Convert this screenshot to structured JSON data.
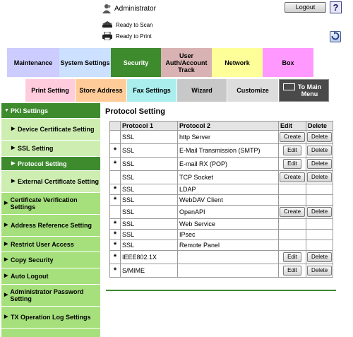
{
  "header": {
    "user": "Administrator",
    "logout_label": "Logout",
    "help_label": "?",
    "status_scan": "Ready to Scan",
    "status_print": "Ready to Print"
  },
  "tabs": [
    {
      "label": "Maintenance",
      "color": "#ccccff"
    },
    {
      "label": "System Settings",
      "color": "#cce0ff"
    },
    {
      "label": "Security",
      "color": "#3e8b2e",
      "active": true
    },
    {
      "label": "User Auth/Account Track",
      "color": "#d9b3b3"
    },
    {
      "label": "Network",
      "color": "#ffff99"
    },
    {
      "label": "Box",
      "color": "#ff99ff"
    }
  ],
  "subtabs": [
    {
      "label": "Print Setting",
      "color": "#ffccdd"
    },
    {
      "label": "Store Address",
      "color": "#ffcc99"
    },
    {
      "label": "Fax Settings",
      "color": "#aaeeee"
    },
    {
      "label": "Wizard",
      "color": "#c8c8c8"
    },
    {
      "label": "Customize",
      "color": "#dddddd"
    },
    {
      "label": "To Main Menu",
      "color": "#4a4a4a"
    }
  ],
  "sidebar": {
    "items": [
      {
        "label": "PKI Settings",
        "kind": "header"
      },
      {
        "label": "Device Certificate Setting",
        "kind": "sub"
      },
      {
        "label": "SSL Setting",
        "kind": "sub"
      },
      {
        "label": "Protocol Setting",
        "kind": "sub-active"
      },
      {
        "label": "External Certificate Setting",
        "kind": "sub"
      },
      {
        "label": "Certificate Verification Settings",
        "kind": "top"
      },
      {
        "label": "Address Reference Setting",
        "kind": "top"
      },
      {
        "label": "Restrict User Access",
        "kind": "top"
      },
      {
        "label": "Copy Security",
        "kind": "top"
      },
      {
        "label": "Auto Logout",
        "kind": "top"
      },
      {
        "label": "Administrator Password Setting",
        "kind": "top"
      },
      {
        "label": "TX Operation Log Settings",
        "kind": "top"
      }
    ]
  },
  "main": {
    "title": "Protocol Setting",
    "columns": [
      "",
      "Protocol 1",
      "Protocol 2",
      "Edit",
      "Delete"
    ],
    "rows": [
      {
        "star": "",
        "p1": "SSL",
        "p2": "http Server",
        "edit": "Create",
        "delete": "Delete"
      },
      {
        "star": "*",
        "p1": "SSL",
        "p2": "E-Mail Transmission (SMTP)",
        "edit": "Edit",
        "delete": "Delete"
      },
      {
        "star": "*",
        "p1": "SSL",
        "p2": "E-mail RX (POP)",
        "edit": "Edit",
        "delete": "Delete"
      },
      {
        "star": "",
        "p1": "SSL",
        "p2": "TCP Socket",
        "edit": "Create",
        "delete": "Delete"
      },
      {
        "star": "*",
        "p1": "SSL",
        "p2": "LDAP",
        "edit": "",
        "delete": ""
      },
      {
        "star": "*",
        "p1": "SSL",
        "p2": "WebDAV Client",
        "edit": "",
        "delete": ""
      },
      {
        "star": "",
        "p1": "SSL",
        "p2": "OpenAPI",
        "edit": "Create",
        "delete": "Delete"
      },
      {
        "star": "*",
        "p1": "SSL",
        "p2": "Web Service",
        "edit": "",
        "delete": ""
      },
      {
        "star": "*",
        "p1": "SSL",
        "p2": "IPsec",
        "edit": "",
        "delete": ""
      },
      {
        "star": "*",
        "p1": "SSL",
        "p2": "Remote Panel",
        "edit": "",
        "delete": ""
      },
      {
        "star": "*",
        "p1": "IEEE802.1X",
        "p2": "",
        "edit": "Edit",
        "delete": "Delete"
      },
      {
        "star": "*",
        "p1": "S/MIME",
        "p2": "",
        "edit": "Edit",
        "delete": "Delete"
      }
    ]
  },
  "icons": {
    "user": "user-icon",
    "scanner": "scanner-icon",
    "printer": "printer-icon",
    "refresh": "refresh-icon",
    "menu": "main-menu-icon"
  }
}
